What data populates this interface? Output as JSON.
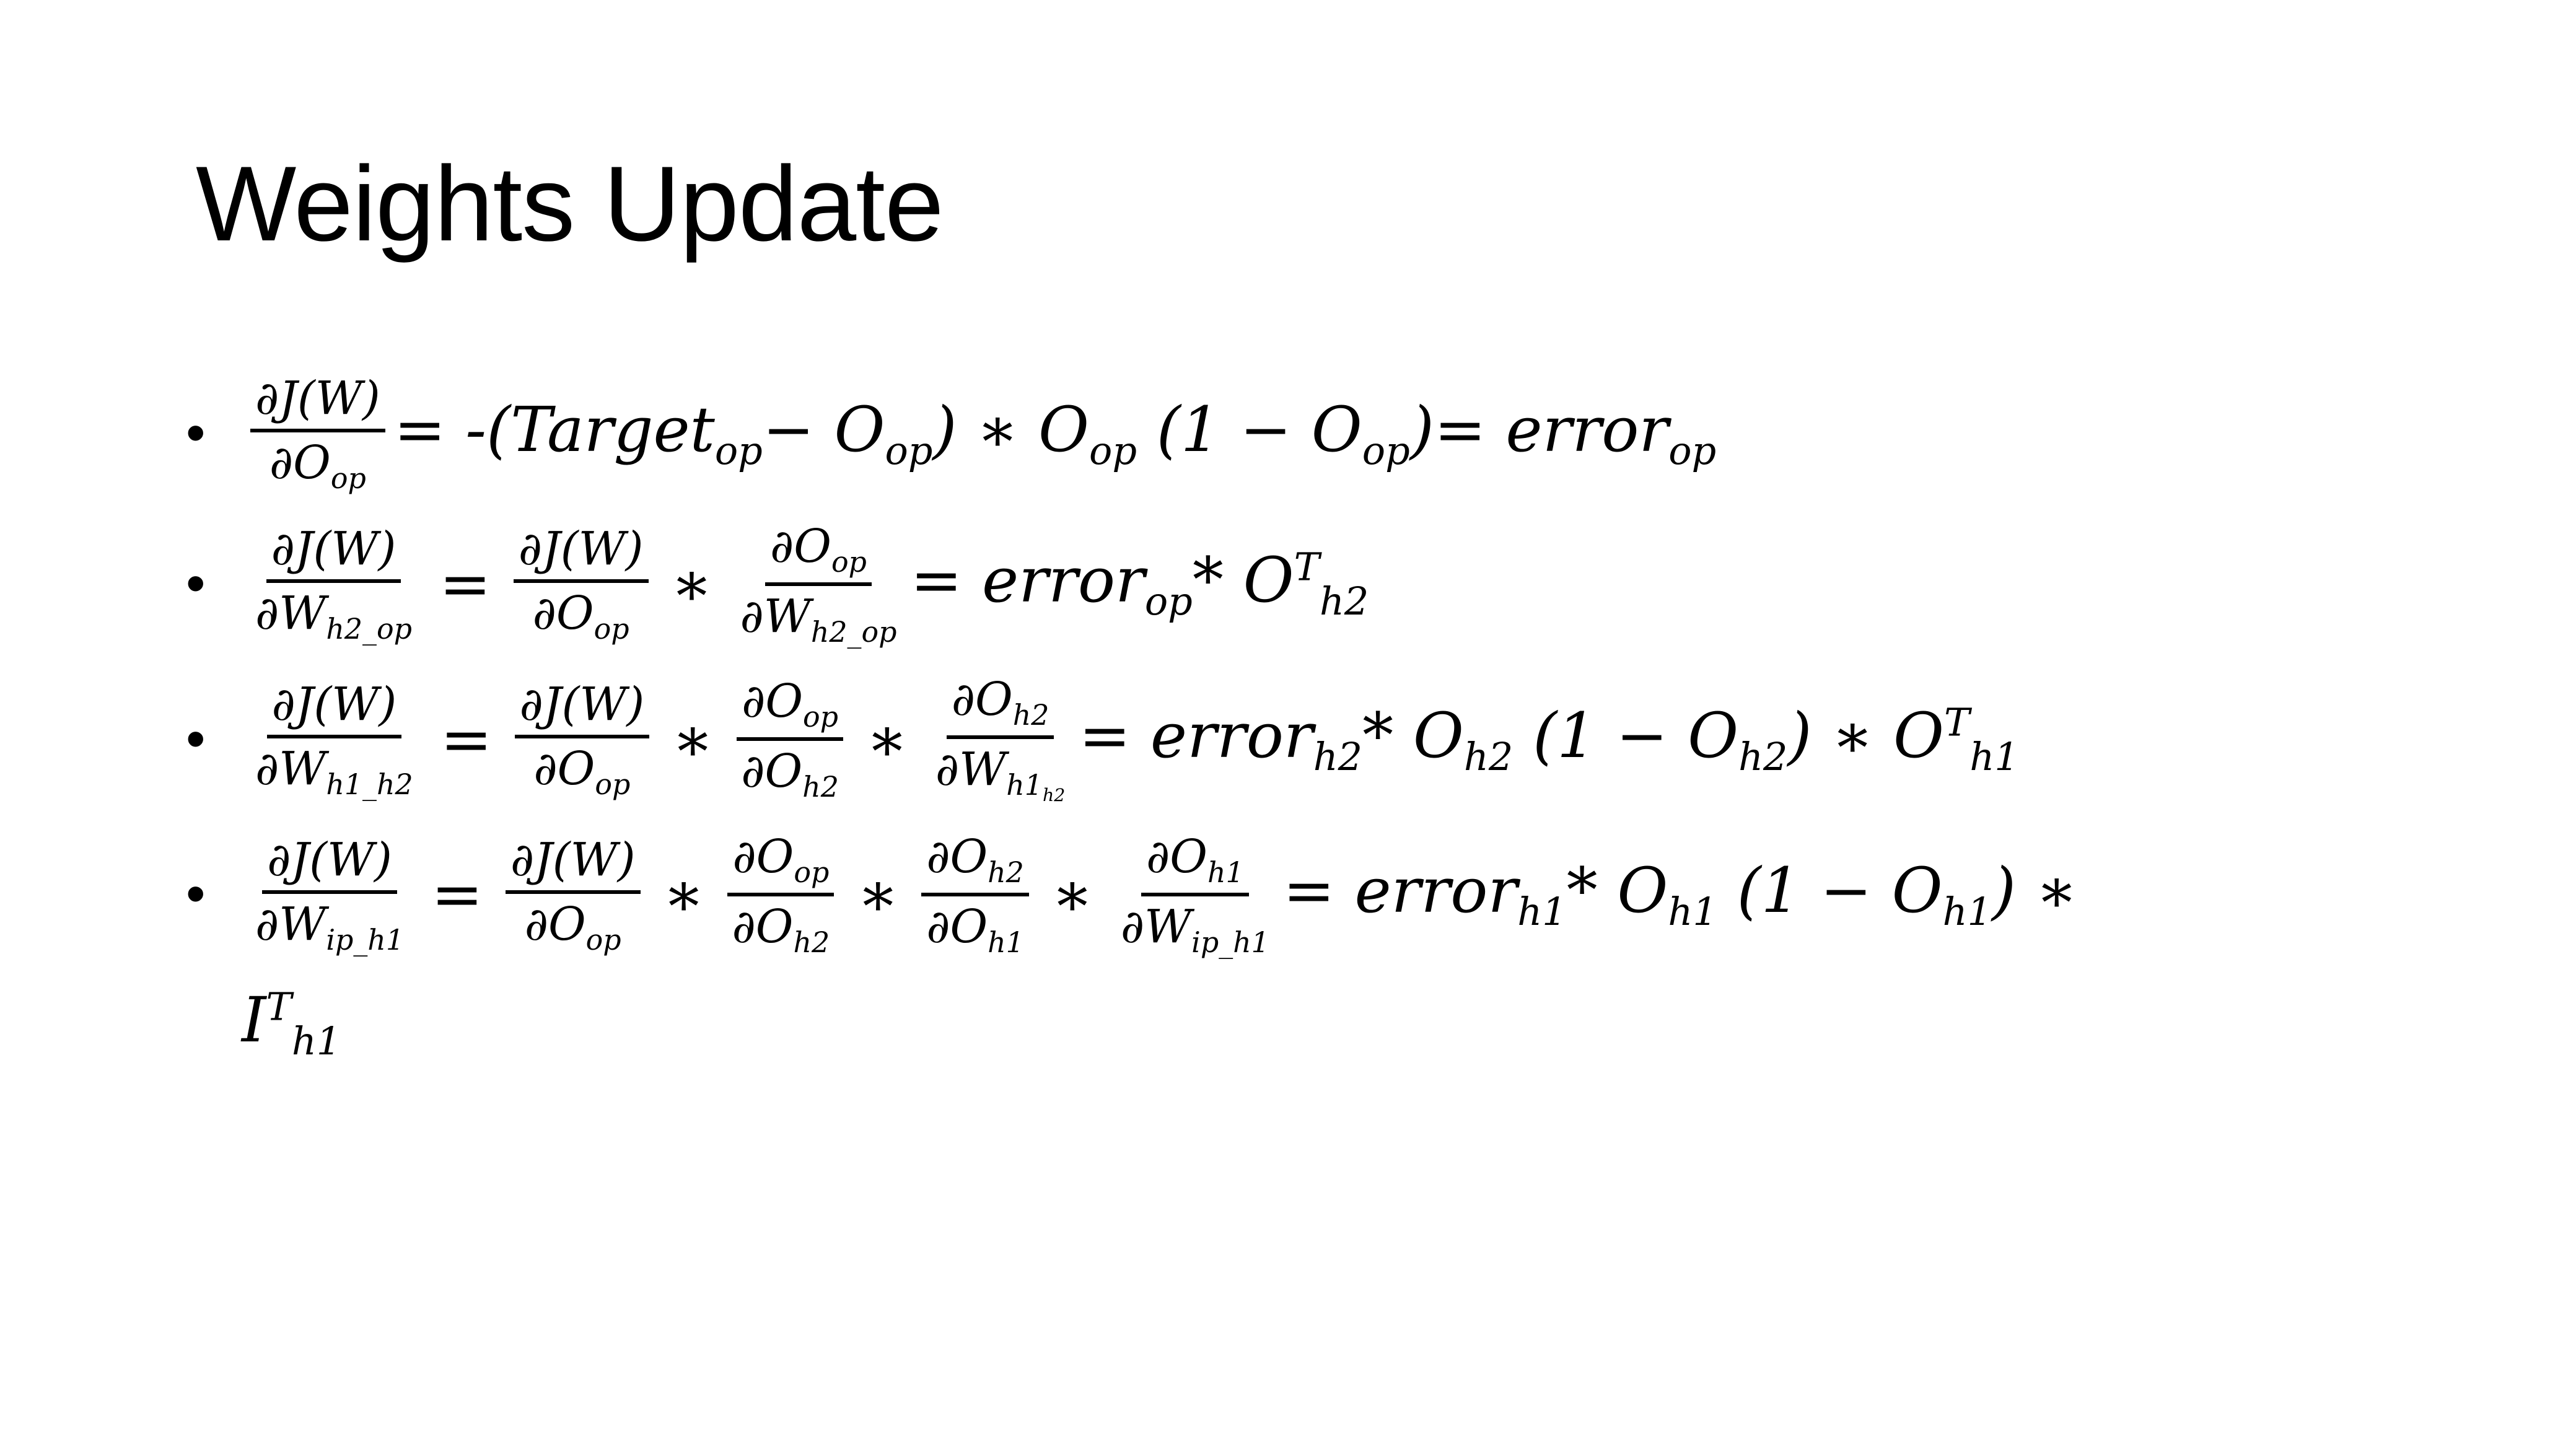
{
  "title": "Weights Update",
  "eq": {
    "one": {
      "num": "∂J(W)",
      "den": "∂O",
      "den_sub": "op",
      "part1": "= -(Target",
      "part1_sub": "op",
      "part2": "− O",
      "part2_sub": "op",
      "part3": ") ∗ O",
      "part3_sub": "op",
      "part4": " (1 − O",
      "part4_sub": "op",
      "part5": ")= error",
      "part5_sub": "op"
    },
    "two": {
      "lhs_num": "∂J(W)",
      "lhs_den": "∂W",
      "lhs_den_sub": "h2_op",
      "f1_num": "∂J(W)",
      "f1_den": "∂O",
      "f1_den_sub": "op",
      "f2_num": "∂O",
      "f2_num_sub": "op",
      "f2_den": "∂W",
      "f2_den_sub": "h2_op",
      "r1": "= error",
      "r1_sub": "op",
      "r2": "* O",
      "r2_sup": "T",
      "r2_sub": "h2"
    },
    "three": {
      "lhs_num": "∂J(W)",
      "lhs_den": "∂W",
      "lhs_den_sub": "h1_h2",
      "f1_num": "∂J(W)",
      "f1_den": "∂O",
      "f1_den_sub": "op",
      "f2_num": "∂O",
      "f2_num_sub": "op",
      "f2_den": "∂O",
      "f2_den_sub": "h2",
      "f3_num": "∂O",
      "f3_num_sub": "h2",
      "f3_den": "∂W",
      "f3_den_sub": "h1",
      "f3_den_subsub": "h2",
      "r1": "= error",
      "r1_sub": "h2",
      "r2": "* O",
      "r2_sub": "h2",
      "r3": " (1 − O",
      "r3_sub": "h2",
      "r4": ") ∗ O",
      "r4_sup": "T",
      "r4_sub": "h1"
    },
    "four": {
      "lhs_num": "∂J(W)",
      "lhs_den": "∂W",
      "lhs_den_sub": "ip_h1",
      "f1_num": "∂J(W)",
      "f1_den": "∂O",
      "f1_den_sub": "op",
      "f2_num": "∂O",
      "f2_num_sub": "op",
      "f2_den": "∂O",
      "f2_den_sub": "h2",
      "f3_num": "∂O",
      "f3_num_sub": "h2",
      "f3_den": "∂O",
      "f3_den_sub": "h1",
      "f4_num": "∂O",
      "f4_num_sub": "h1",
      "f4_den": "∂W",
      "f4_den_sub": "ip_h1",
      "r1": "= error",
      "r1_sub": "h1",
      "r2": "* O",
      "r2_sub": "h1",
      "r3": " (1 − O",
      "r3_sub": "h1",
      "r4": ") ∗",
      "cont": "I",
      "cont_sup": "T",
      "cont_sub": "h1"
    },
    "times": "∗",
    "equals": "=",
    "bullet": "•"
  }
}
